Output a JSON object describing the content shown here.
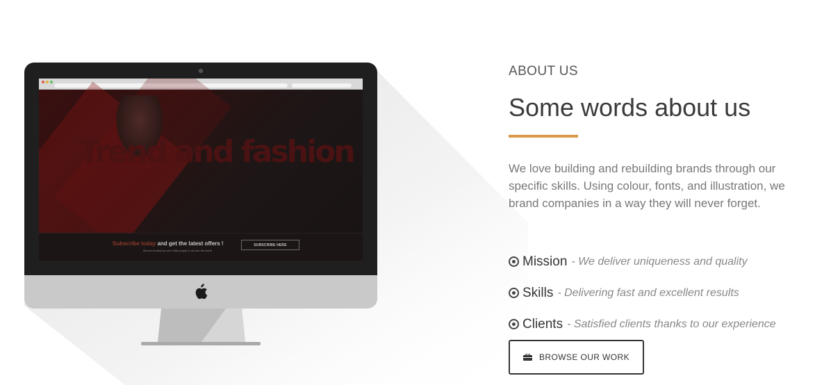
{
  "device_screen": {
    "hero_title": "Trend and fashion",
    "subscribe_highlight": "Subscribe today",
    "subscribe_rest": " and get the latest offers !",
    "subscribe_small": "We are trusted by over 100k people in all over the world",
    "subscribe_button": "SUBSCRIBE HERE"
  },
  "about": {
    "eyebrow": "ABOUT US",
    "headline": "Some words about us",
    "lead": "We love building and rebuilding brands through our specific skills. Using colour, fonts, and illustration, we brand companies in a way they will never forget.",
    "accent_color": "#d9994a"
  },
  "features": [
    {
      "name": "Mission",
      "desc": "- We deliver uniqueness and quality",
      "icon": "target-icon"
    },
    {
      "name": "Skills",
      "desc": "- Delivering fast and excellent results",
      "icon": "target-icon"
    },
    {
      "name": "Clients",
      "desc": "- Satisfied clients thanks to our experience",
      "icon": "target-icon"
    }
  ],
  "cta": {
    "label": "BROWSE OUR WORK",
    "icon": "briefcase-icon"
  }
}
